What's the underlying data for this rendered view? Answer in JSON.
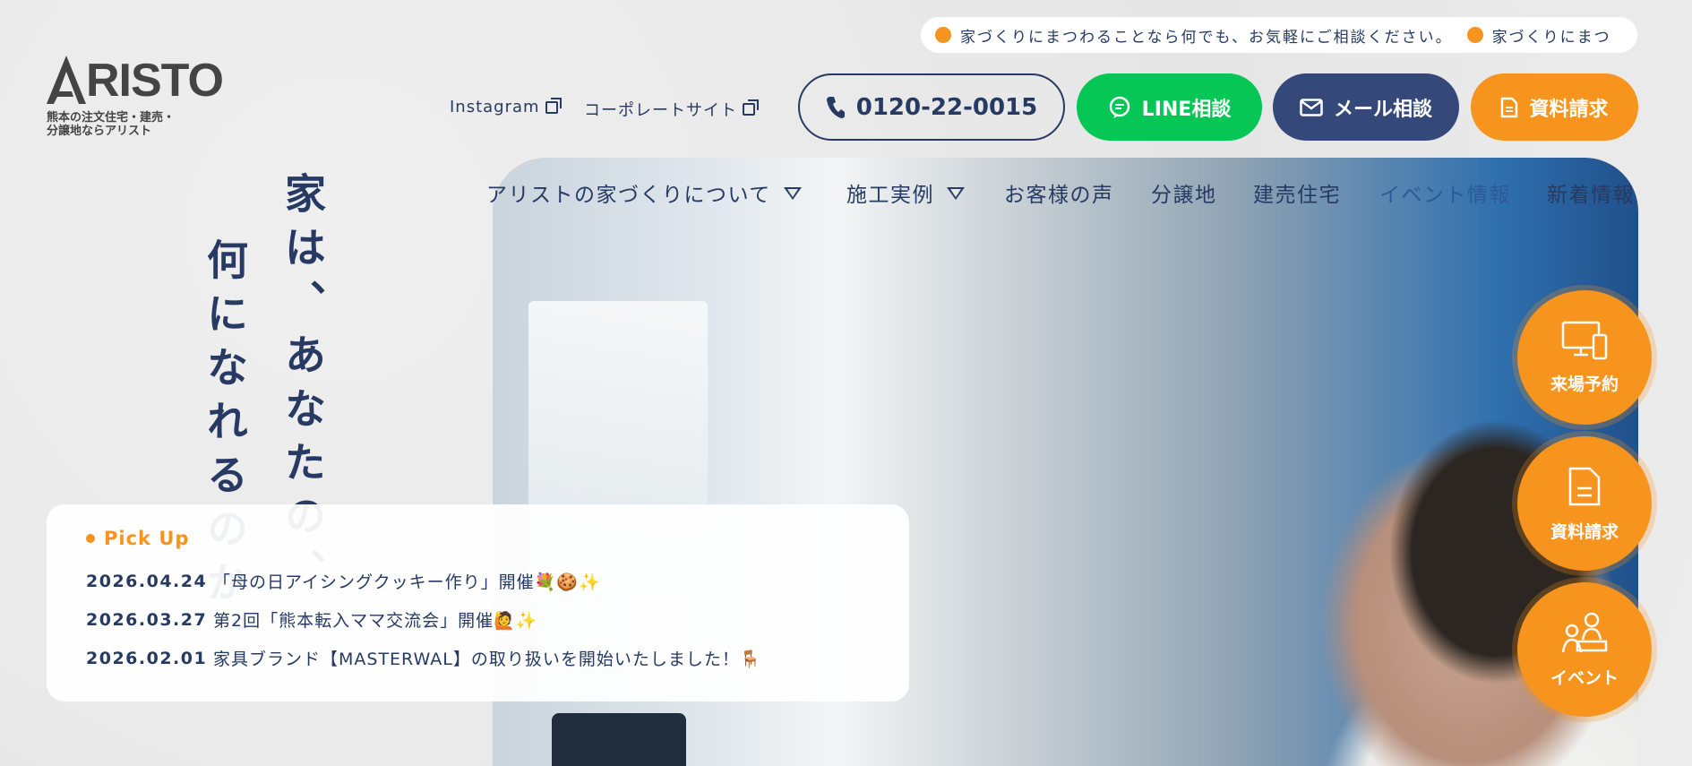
{
  "ticker": {
    "items": [
      "家づくりにまつわることなら何でも、お気軽にご相談ください。",
      "家づくりにまつ"
    ]
  },
  "logo": {
    "word": "RISTO",
    "subtitle_line1": "熊本の注文住宅・建売・",
    "subtitle_line2": "分譲地ならアリスト"
  },
  "header": {
    "instagram": "Instagram",
    "corporate": "コーポレートサイト",
    "phone": "0120-22-0015",
    "line": "LINE相談",
    "mail": "メール相談",
    "request": "資料請求"
  },
  "nav": {
    "items": [
      "アリストの家づくりについて",
      "施工実例",
      "お客様の声",
      "分譲地",
      "建売住宅",
      "イベント情報",
      "新着情報"
    ]
  },
  "catch": {
    "col1": "家は、あなたの、",
    "col2": "何になれるのか。"
  },
  "pickup": {
    "title": "Pick Up",
    "news": [
      {
        "date": "2026.04.24",
        "text": "「母の日アイシングクッキー作り」開催💐🍪✨"
      },
      {
        "date": "2026.03.27",
        "text": "第2回「熊本転入ママ交流会」開催🙋✨"
      },
      {
        "date": "2026.02.01",
        "text": "家具ブランド【MASTERWAL】の取り扱いを開始いたしました！🪑"
      }
    ]
  },
  "side": {
    "visit": "来場予約",
    "request": "資料請求",
    "event": "イベント"
  },
  "colors": {
    "navy": "#263a63",
    "orange": "#f7941d",
    "line_green": "#06c755",
    "mail_blue": "#34497a"
  }
}
